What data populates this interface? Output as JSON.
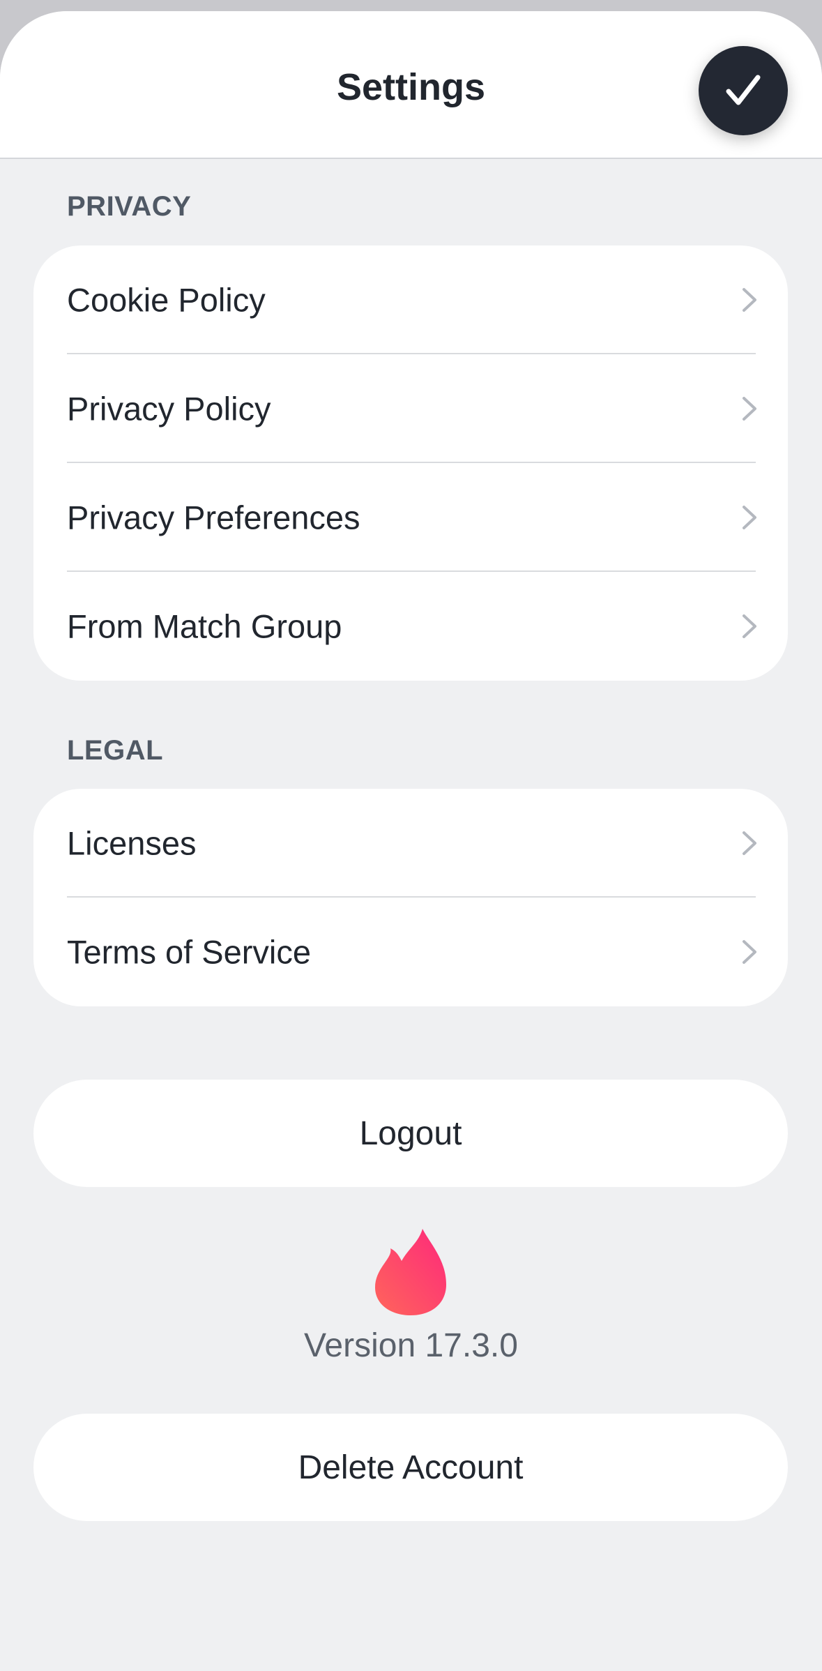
{
  "header": {
    "title": "Settings",
    "done_icon": "checkmark-icon"
  },
  "sections": [
    {
      "label": "PRIVACY",
      "items": [
        {
          "label": "Cookie Policy"
        },
        {
          "label": "Privacy Policy"
        },
        {
          "label": "Privacy Preferences"
        },
        {
          "label": "From Match Group"
        }
      ]
    },
    {
      "label": "LEGAL",
      "items": [
        {
          "label": "Licenses"
        },
        {
          "label": "Terms of Service"
        }
      ]
    }
  ],
  "logout": {
    "label": "Logout"
  },
  "app_info": {
    "logo_icon": "flame-icon",
    "version": "Version 17.3.0"
  },
  "delete_account": {
    "label": "Delete Account"
  },
  "colors": {
    "background": "#eff0f2",
    "card": "#ffffff",
    "text": "#21262e",
    "section_label": "#505965",
    "done_button": "#232833",
    "flame_start": "#fd297b",
    "flame_end": "#ff655b"
  }
}
